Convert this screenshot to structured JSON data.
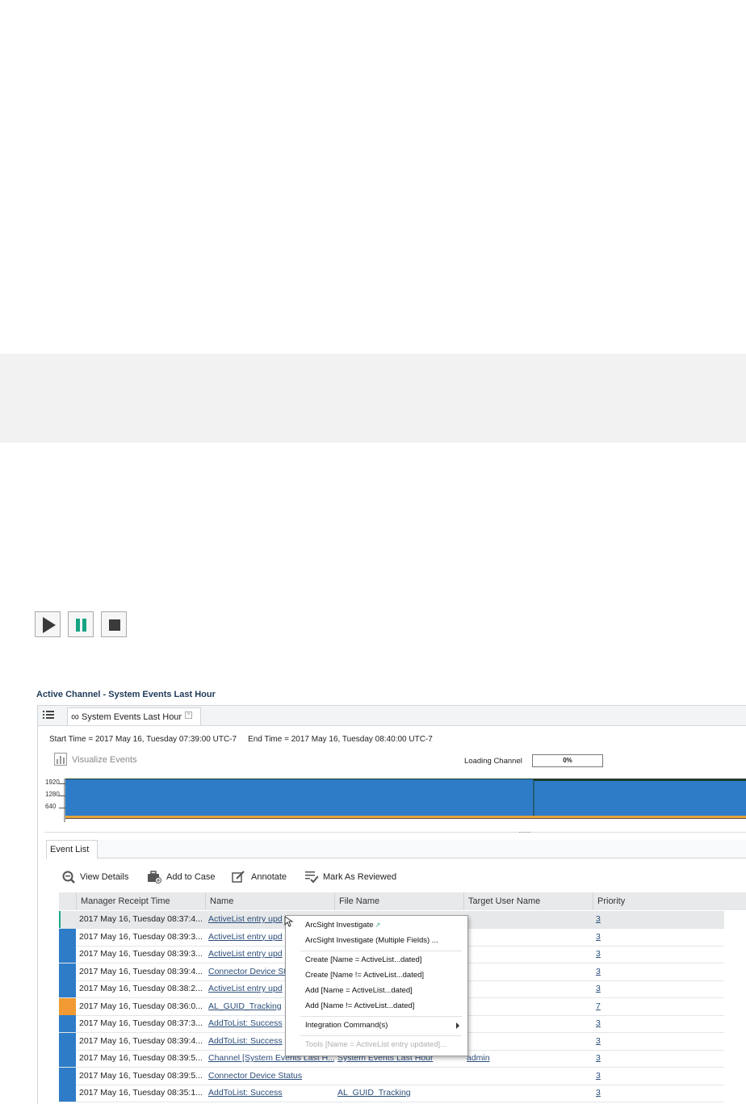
{
  "player": {
    "play_icon": "play-icon",
    "pause_icon": "pause-icon",
    "stop_icon": "stop-icon",
    "pause_color": "#16a583"
  },
  "channel_heading": "Active Channel - System Events Last Hour",
  "channel_tab": {
    "menu_icon": "list-menu-icon",
    "tab_icon": "infinity-icon",
    "label": "System Events Last Hour"
  },
  "time_range": {
    "start": "Start Time = 2017 May 16, Tuesday 07:39:00 UTC-7",
    "end": "End Time = 2017 May 16, Tuesday 08:40:00 UTC-7"
  },
  "visualize": {
    "label": "Visualize Events",
    "icon": "bar-chart-icon"
  },
  "loading": {
    "label": "Loading Channel",
    "value": "0%",
    "fraction": 0
  },
  "chart_data": {
    "type": "area",
    "y_ticks": [
      "1920",
      "1280",
      "640"
    ],
    "colors": {
      "fill": "#2e7cc8",
      "bottom_band": "#e7a23a",
      "top_edge": "#1e3d2a"
    }
  },
  "event_tab": "Event List",
  "toolbar": {
    "view_details": "View Details",
    "add_to_case": "Add to Case",
    "annotate": "Annotate",
    "mark_reviewed": "Mark As Reviewed"
  },
  "table": {
    "headers": [
      "Manager Receipt Time",
      "Name",
      "File Name",
      "Target User Name",
      "Priority"
    ],
    "rows": [
      {
        "time": "2017 May 16, Tuesday 08:37:4...",
        "name": "ActiveList entry upd",
        "file": "",
        "user": "",
        "priority": "3",
        "color": "#18a885"
      },
      {
        "time": "2017 May 16, Tuesday 08:39:3...",
        "name": "ActiveList entry upd",
        "file": "",
        "user": "",
        "priority": "3",
        "color": "#2e7cc8"
      },
      {
        "time": "2017 May 16, Tuesday 08:39:3...",
        "name": "ActiveList entry upd",
        "file": "",
        "user": "",
        "priority": "3",
        "color": "#2e7cc8"
      },
      {
        "time": "2017 May 16, Tuesday 08:39:4...",
        "name": "Connector Device St",
        "file": "",
        "user": "",
        "priority": "3",
        "color": "#2e7cc8"
      },
      {
        "time": "2017 May 16, Tuesday 08:38:2...",
        "name": "ActiveList entry upd",
        "file": "",
        "user": "",
        "priority": "3",
        "color": "#2e7cc8"
      },
      {
        "time": "2017 May 16, Tuesday 08:36:0...",
        "name": "AL_GUID_Tracking",
        "file": "",
        "user": "",
        "priority": "7",
        "color": "#f19a33"
      },
      {
        "time": "2017 May 16, Tuesday 08:37:3...",
        "name": "AddToList: Success",
        "file": "",
        "user": "",
        "priority": "3",
        "color": "#2e7cc8"
      },
      {
        "time": "2017 May 16, Tuesday 08:39:4...",
        "name": "AddToList: Success",
        "file": "",
        "user": "",
        "priority": "3",
        "color": "#2e7cc8"
      },
      {
        "time": "2017 May 16, Tuesday 08:39:5...",
        "name": "Channel [System Events Last H...",
        "file": "System Events Last Hour",
        "user": "admin",
        "priority": "3",
        "color": "#2e7cc8"
      },
      {
        "time": "2017 May 16, Tuesday 08:39:5...",
        "name": "Connector Device Status",
        "file": "",
        "user": "",
        "priority": "3",
        "color": "#2e7cc8"
      },
      {
        "time": "2017 May 16, Tuesday 08:35:1...",
        "name": "AddToList: Success",
        "file": "AL_GUID_Tracking",
        "user": "",
        "priority": "3",
        "color": "#2e7cc8"
      }
    ]
  },
  "context_menu": {
    "investigate": "ArcSight Investigate",
    "investigate_multi": "ArcSight Investigate (Multiple Fields) ...",
    "create_eq": "Create [Name = ActiveList...dated]",
    "create_neq": "Create [Name != ActiveList...dated]",
    "add_eq": "Add [Name = ActiveList...dated]",
    "add_neq": "Add [Name != ActiveList...dated]",
    "integration": "Integration Command(s)",
    "tools": "Tools [Name = ActiveList entry updated]..."
  }
}
